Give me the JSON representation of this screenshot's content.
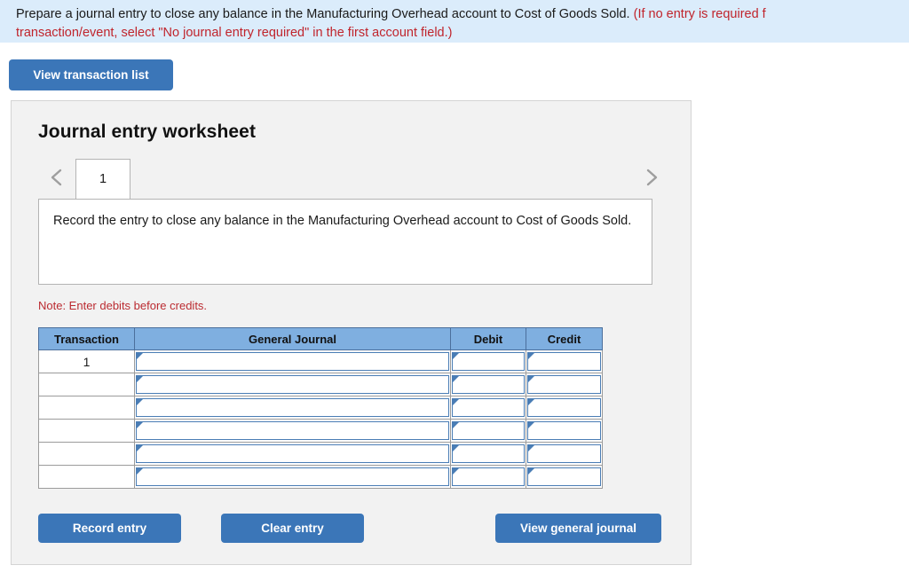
{
  "banner": {
    "line1_black": "Prepare a journal entry to close any balance in the Manufacturing Overhead account to Cost of Goods Sold. ",
    "line1_red": "(If no entry is required f",
    "line2_red": "transaction/event, select \"No journal entry required\" in the first account field.)"
  },
  "toolbar": {
    "view_transaction_list_label": "View transaction list"
  },
  "worksheet": {
    "title": "Journal entry worksheet",
    "tabs": [
      {
        "label": "1"
      }
    ],
    "prev_icon": "chevron-left-icon",
    "next_icon": "chevron-right-icon",
    "instruction": "Record the entry to close any balance in the Manufacturing Overhead account to Cost of Goods Sold.",
    "note": "Note: Enter debits before credits.",
    "table": {
      "headers": [
        "Transaction",
        "General Journal",
        "Debit",
        "Credit"
      ],
      "rows": [
        {
          "transaction": "1",
          "general_journal": "",
          "debit": "",
          "credit": ""
        },
        {
          "transaction": "",
          "general_journal": "",
          "debit": "",
          "credit": ""
        },
        {
          "transaction": "",
          "general_journal": "",
          "debit": "",
          "credit": ""
        },
        {
          "transaction": "",
          "general_journal": "",
          "debit": "",
          "credit": ""
        },
        {
          "transaction": "",
          "general_journal": "",
          "debit": "",
          "credit": ""
        },
        {
          "transaction": "",
          "general_journal": "",
          "debit": "",
          "credit": ""
        }
      ]
    },
    "actions": {
      "record_entry_label": "Record entry",
      "clear_entry_label": "Clear entry",
      "view_general_journal_label": "View general journal"
    }
  },
  "colors": {
    "banner_bg": "#dbecfb",
    "button_blue": "#3b76b8",
    "table_header_blue": "#7fafe0",
    "red_text": "#c0242c",
    "note_red": "#bb2b31",
    "panel_bg": "#f2f2f2"
  }
}
